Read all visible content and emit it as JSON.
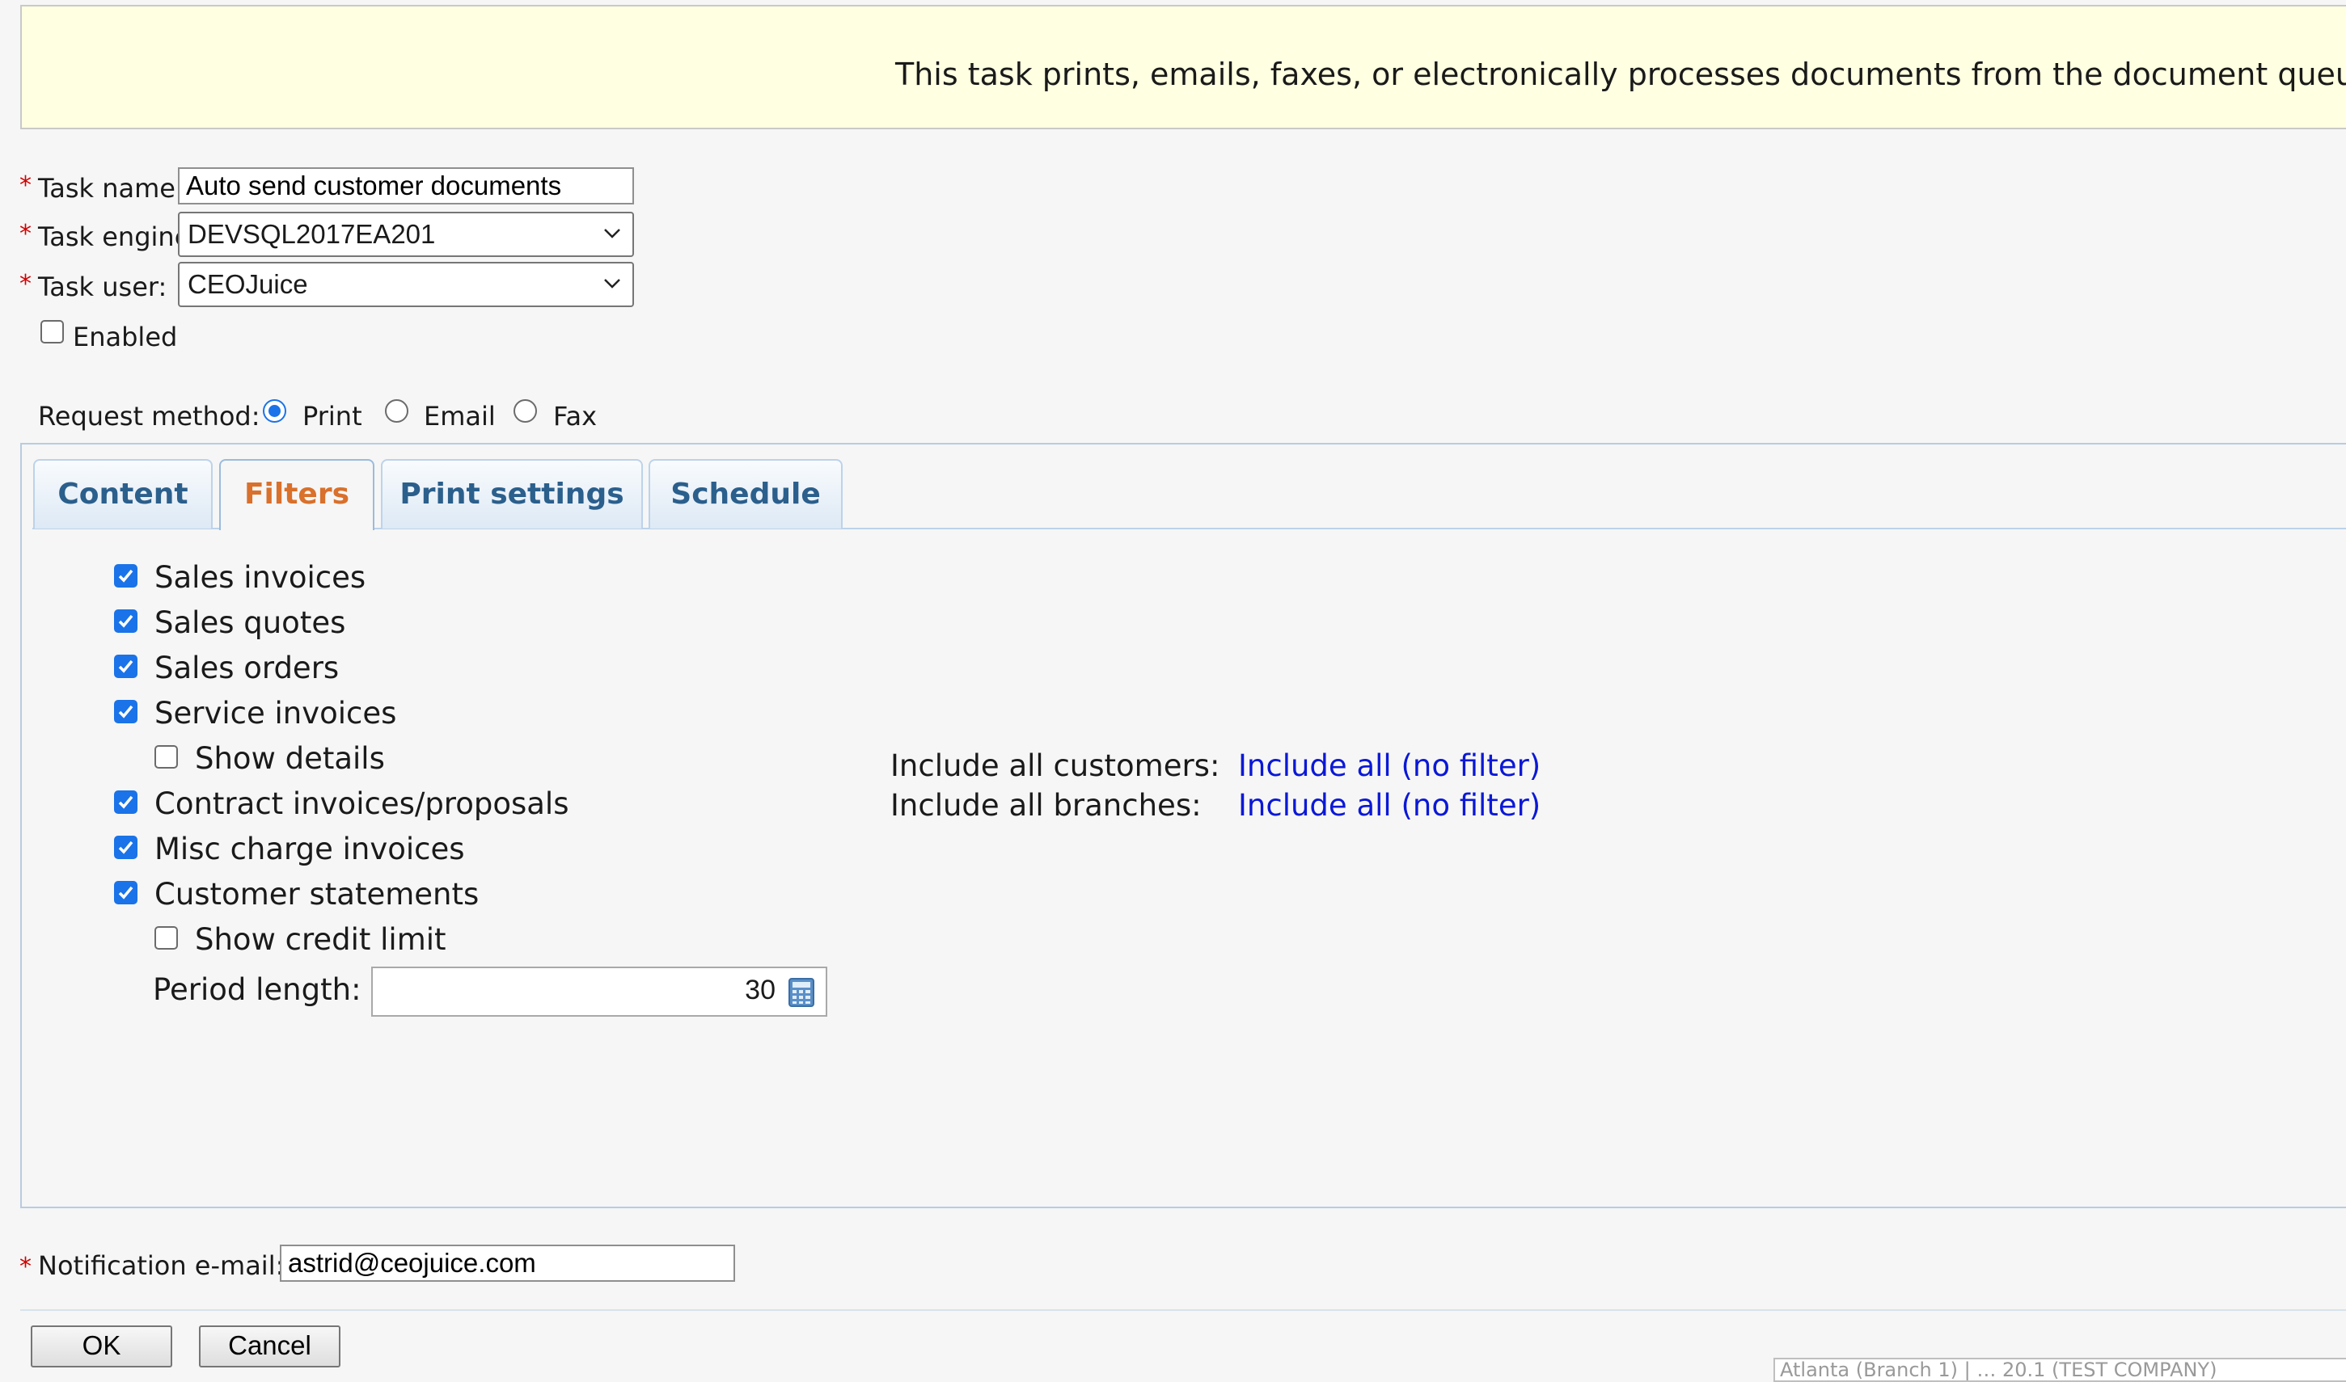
{
  "banner": {
    "text": "This task prints, emails, faxes, or electronically processes documents from the document queue."
  },
  "form": {
    "required_mark": "*",
    "task_name": {
      "label": "Task name:",
      "value": "Auto send customer documents"
    },
    "task_engine": {
      "label": "Task engine:",
      "value": "DEVSQL2017EA201"
    },
    "task_user": {
      "label": "Task user:",
      "value": "CEOJuice"
    },
    "enabled": {
      "label": "Enabled",
      "checked": false
    },
    "request_method": {
      "label": "Request method:",
      "options": [
        {
          "label": "Print",
          "selected": true
        },
        {
          "label": "Email",
          "selected": false
        },
        {
          "label": "Fax",
          "selected": false
        }
      ]
    }
  },
  "tabs": [
    {
      "label": "Content",
      "active": false
    },
    {
      "label": "Filters",
      "active": true
    },
    {
      "label": "Print settings",
      "active": false
    },
    {
      "label": "Schedule",
      "active": false
    }
  ],
  "filters": {
    "items": [
      {
        "label": "Sales invoices",
        "checked": true
      },
      {
        "label": "Sales quotes",
        "checked": true
      },
      {
        "label": "Sales orders",
        "checked": true
      },
      {
        "label": "Service invoices",
        "checked": true
      },
      {
        "label": "Show details",
        "checked": false
      },
      {
        "label": "Contract invoices/proposals",
        "checked": true
      },
      {
        "label": "Misc charge invoices",
        "checked": true
      },
      {
        "label": "Customer statements",
        "checked": true
      },
      {
        "label": "Show credit limit",
        "checked": false
      }
    ],
    "period_length": {
      "label": "Period length:",
      "value": "30"
    },
    "customers": {
      "label": "Include all customers:",
      "link": "Include all (no filter)"
    },
    "branches": {
      "label": "Include all branches:",
      "link": "Include all (no filter)"
    }
  },
  "notification": {
    "label": "Notification e-mail:",
    "value": "astrid@ceojuice.com"
  },
  "buttons": {
    "ok": "OK",
    "cancel": "Cancel"
  },
  "status_bar": {
    "text": "Atlanta (Branch 1) | … 20.1 (TEST COMPANY)"
  }
}
